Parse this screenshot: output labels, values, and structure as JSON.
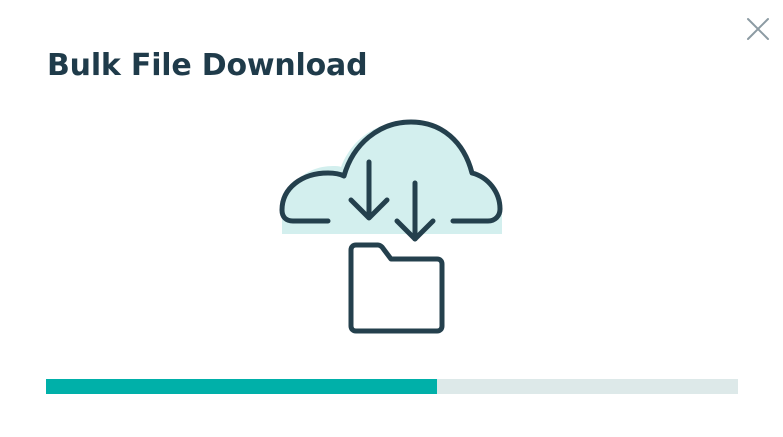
{
  "dialog": {
    "title": "Bulk File Download"
  },
  "icons": {
    "close": "close-icon",
    "illustration": "cloud-download-folder-icon"
  },
  "progress": {
    "percent": 56.5
  },
  "colors": {
    "title": "#1f3b4a",
    "progress_fill": "#00b0a9",
    "progress_track": "#dde9e9",
    "cloud_fill": "#d3efee",
    "stroke": "#24404d",
    "close_icon": "#8c9ba3"
  }
}
